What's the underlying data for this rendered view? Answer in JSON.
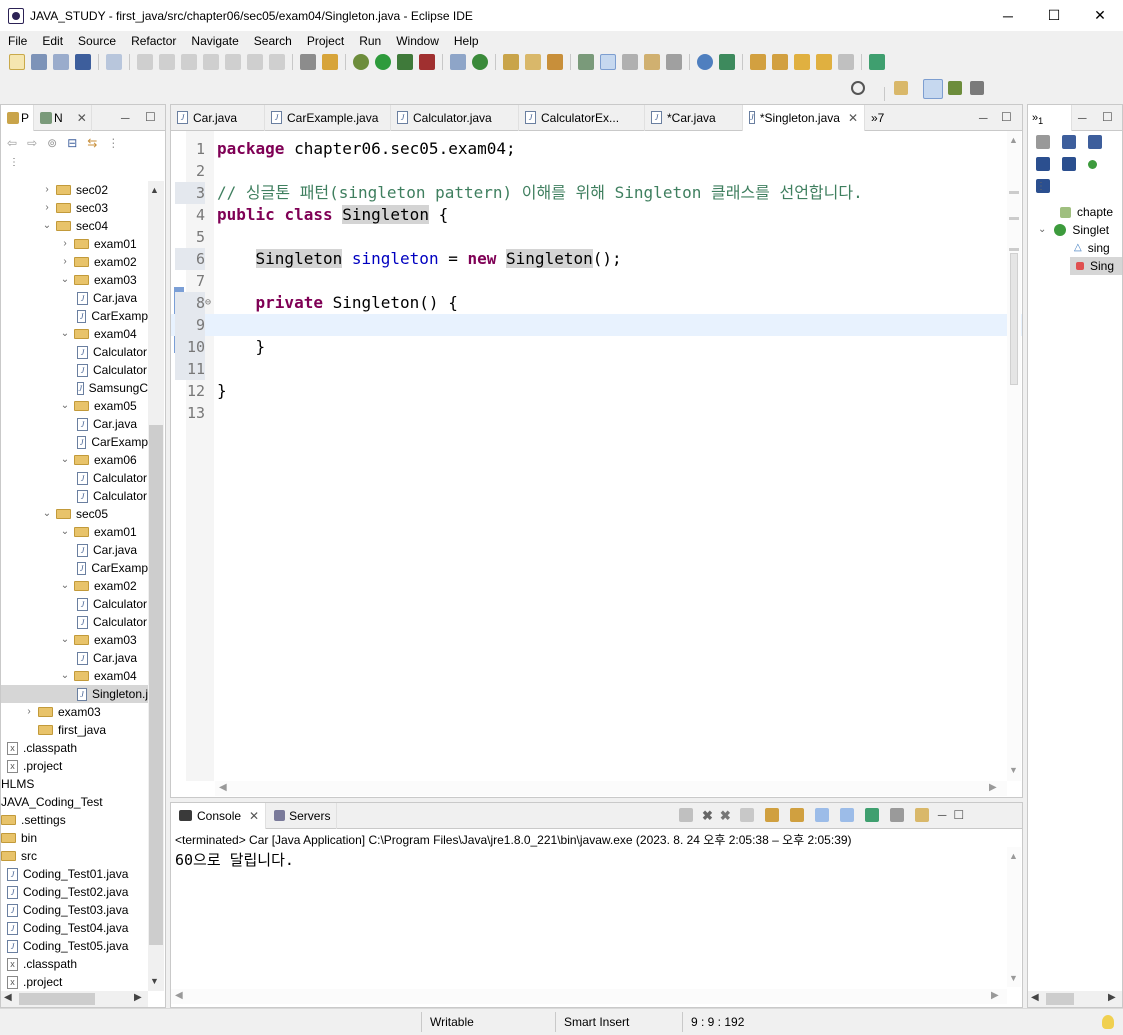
{
  "window": {
    "title": "JAVA_STUDY - first_java/src/chapter06/sec05/exam04/Singleton.java - Eclipse IDE",
    "minimize": "─",
    "maximize": "☐",
    "close": "✕"
  },
  "menu": [
    "File",
    "Edit",
    "Source",
    "Refactor",
    "Navigate",
    "Search",
    "Project",
    "Run",
    "Window",
    "Help"
  ],
  "explorer": {
    "tab1": "P",
    "tab2": "N",
    "tree": [
      {
        "label": "sec02",
        "indent": 1,
        "type": "folder",
        "expanded": false
      },
      {
        "label": "sec03",
        "indent": 1,
        "type": "folder",
        "expanded": false
      },
      {
        "label": "sec04",
        "indent": 1,
        "type": "folder",
        "expanded": true
      },
      {
        "label": "exam01",
        "indent": 2,
        "type": "folder",
        "expanded": false
      },
      {
        "label": "exam02",
        "indent": 2,
        "type": "folder",
        "expanded": false
      },
      {
        "label": "exam03",
        "indent": 2,
        "type": "folder",
        "expanded": true
      },
      {
        "label": "Car.java",
        "indent": 3,
        "type": "java"
      },
      {
        "label": "CarExamp",
        "indent": 3,
        "type": "java"
      },
      {
        "label": "exam04",
        "indent": 2,
        "type": "folder",
        "expanded": true
      },
      {
        "label": "Calculator",
        "indent": 3,
        "type": "java"
      },
      {
        "label": "Calculator",
        "indent": 3,
        "type": "java"
      },
      {
        "label": "SamsungC",
        "indent": 3,
        "type": "java"
      },
      {
        "label": "exam05",
        "indent": 2,
        "type": "folder",
        "expanded": true
      },
      {
        "label": "Car.java",
        "indent": 3,
        "type": "java"
      },
      {
        "label": "CarExamp",
        "indent": 3,
        "type": "java"
      },
      {
        "label": "exam06",
        "indent": 2,
        "type": "folder",
        "expanded": true
      },
      {
        "label": "Calculator",
        "indent": 3,
        "type": "java"
      },
      {
        "label": "Calculator",
        "indent": 3,
        "type": "java"
      },
      {
        "label": "sec05",
        "indent": 1,
        "type": "folder",
        "expanded": true
      },
      {
        "label": "exam01",
        "indent": 2,
        "type": "folder",
        "expanded": true
      },
      {
        "label": "Car.java",
        "indent": 3,
        "type": "java"
      },
      {
        "label": "CarExamp",
        "indent": 3,
        "type": "java"
      },
      {
        "label": "exam02",
        "indent": 2,
        "type": "folder",
        "expanded": true
      },
      {
        "label": "Calculator",
        "indent": 3,
        "type": "java"
      },
      {
        "label": "Calculator",
        "indent": 3,
        "type": "java"
      },
      {
        "label": "exam03",
        "indent": 2,
        "type": "folder",
        "expanded": true
      },
      {
        "label": "Car.java",
        "indent": 3,
        "type": "java"
      },
      {
        "label": "exam04",
        "indent": 2,
        "type": "folder",
        "expanded": true
      },
      {
        "label": "Singleton.j",
        "indent": 3,
        "type": "java",
        "selected": true
      },
      {
        "label": "exam03",
        "indent": 0,
        "type": "folder",
        "expanded": false
      },
      {
        "label": "first_java",
        "indent": 0,
        "type": "folder",
        "noarrow": true
      },
      {
        "label": ".classpath",
        "indent": -1,
        "type": "xml"
      },
      {
        "label": ".project",
        "indent": -1,
        "type": "xml"
      },
      {
        "label": "HLMS",
        "indent": -2,
        "type": "text"
      },
      {
        "label": "JAVA_Coding_Test",
        "indent": -2,
        "type": "text"
      },
      {
        "label": ".settings",
        "indent": -2,
        "type": "folder"
      },
      {
        "label": "bin",
        "indent": -2,
        "type": "folder"
      },
      {
        "label": "src",
        "indent": -2,
        "type": "folder"
      },
      {
        "label": "Coding_Test01.java",
        "indent": -1,
        "type": "java"
      },
      {
        "label": "Coding_Test02.java",
        "indent": -1,
        "type": "java"
      },
      {
        "label": "Coding_Test03.java",
        "indent": -1,
        "type": "java"
      },
      {
        "label": "Coding_Test04.java",
        "indent": -1,
        "type": "java"
      },
      {
        "label": "Coding_Test05.java",
        "indent": -1,
        "type": "java"
      },
      {
        "label": ".classpath",
        "indent": -1,
        "type": "xml"
      },
      {
        "label": ".project",
        "indent": -1,
        "type": "xml"
      }
    ]
  },
  "editor": {
    "tabs": [
      {
        "label": "Car.java",
        "active": false
      },
      {
        "label": "CarExample.java",
        "active": false
      },
      {
        "label": "Calculator.java",
        "active": false
      },
      {
        "label": "CalculatorEx...",
        "active": false
      },
      {
        "label": "*Car.java",
        "active": false
      },
      {
        "label": "*Singleton.java",
        "active": true
      }
    ],
    "overflow": "»7",
    "lines": [
      {
        "n": "1",
        "html": "<span class=\"kw\">package</span> chapter06.sec05.exam04;"
      },
      {
        "n": "2",
        "html": ""
      },
      {
        "n": "3",
        "html": "<span class=\"cm\">// 싱글톤 패턴(singleton pattern) 이해를 위해 Singleton 클래스를 선언합니다.</span>"
      },
      {
        "n": "4",
        "html": "<span class=\"kw\">public</span> <span class=\"kw\">class</span> <span class=\"hl\">Singleton</span> {"
      },
      {
        "n": "5",
        "html": ""
      },
      {
        "n": "6",
        "html": "    <span class=\"hl\">Singleton</span> <span class=\"fd\">singleton</span> = <span class=\"kw\">new</span> <span class=\"hl\">Singleton</span>();"
      },
      {
        "n": "7",
        "html": ""
      },
      {
        "n": "8",
        "html": "    <span class=\"kw\">private</span> Singleton() {"
      },
      {
        "n": "9",
        "html": ""
      },
      {
        "n": "10",
        "html": "    }"
      },
      {
        "n": "11",
        "html": ""
      },
      {
        "n": "12",
        "html": "}"
      },
      {
        "n": "13",
        "html": ""
      }
    ]
  },
  "outline": {
    "items": [
      {
        "label": "chapte",
        "kind": "package"
      },
      {
        "label": "Singlet",
        "kind": "class"
      },
      {
        "label": "sing",
        "kind": "field"
      },
      {
        "label": "Sing",
        "kind": "constructor"
      }
    ],
    "tab_label": "1"
  },
  "console": {
    "tab_console": "Console",
    "tab_servers": "Servers",
    "header": "<terminated> Car [Java Application] C:\\Program Files\\Java\\jre1.8.0_221\\bin\\javaw.exe  (2023. 8. 24 오후 2:05:38 – 오후 2:05:39)",
    "output": "60으로 달립니다."
  },
  "status": {
    "writable": "Writable",
    "insert": "Smart Insert",
    "position": "9 : 9 : 192"
  }
}
